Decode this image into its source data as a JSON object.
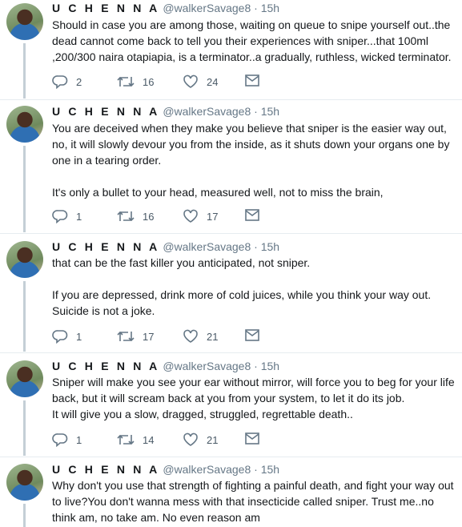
{
  "tweets": [
    {
      "name": "U C H E N N A",
      "handle": "@walkerSavage8",
      "dot": "·",
      "time": "15h",
      "text": "Should in case you are among those, waiting on queue to snipe yourself out..the dead cannot come back to tell you their experiences with sniper...that 100ml ,200/300 naira otapiapia, is a terminator..a gradually, ruthless, wicked terminator.",
      "replies": "2",
      "retweets": "16",
      "likes": "24"
    },
    {
      "name": "U C H E N N A",
      "handle": "@walkerSavage8",
      "dot": "·",
      "time": "15h",
      "text": "You are deceived when they make you believe that sniper is the easier way out, no, it will slowly devour you from the inside, as it shuts down your organs one by one in a tearing order.\n\nIt's only a bullet to your head, measured well, not to miss the brain,",
      "replies": "1",
      "retweets": "16",
      "likes": "17"
    },
    {
      "name": "U C H E N N A",
      "handle": "@walkerSavage8",
      "dot": "·",
      "time": "15h",
      "text": "that can be the fast killer you anticipated, not sniper.\n\nIf you are depressed, drink more of cold juices, while you think your way out. Suicide is not a joke.",
      "replies": "1",
      "retweets": "17",
      "likes": "21"
    },
    {
      "name": "U C H E N N A",
      "handle": "@walkerSavage8",
      "dot": "·",
      "time": "15h",
      "text": "Sniper will make you see your ear without mirror, will force you to beg for your life back, but it will scream back at you from your system, to let it do its job.\nIt will give you a slow, dragged, struggled, regrettable death..",
      "replies": "1",
      "retweets": "14",
      "likes": "21"
    },
    {
      "name": "U C H E N N A",
      "handle": "@walkerSavage8",
      "dot": "·",
      "time": "15h",
      "text": "Why don't you use that strength of fighting a painful death, and fight your way out to live?You don't wanna mess with that insecticide called sniper. Trust me..no think am, no take am. No even reason am",
      "replies": "",
      "retweets": "",
      "likes": ""
    }
  ],
  "icons": {
    "reply": "reply-icon",
    "retweet": "retweet-icon",
    "like": "heart-icon",
    "dm": "envelope-icon"
  },
  "colors": {
    "text": "#14171a",
    "muted": "#657786",
    "thread_line": "#c4cfd6",
    "divider": "#e6ecf0"
  }
}
